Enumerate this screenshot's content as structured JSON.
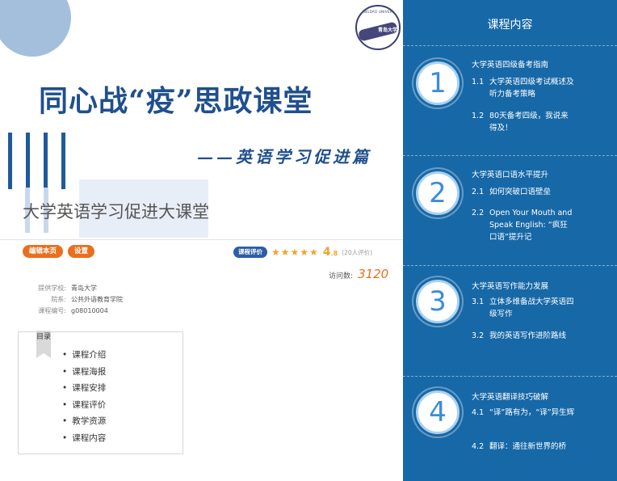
{
  "hero": {
    "title": "同心战“疫”思政课堂",
    "subtitle": "——英语学习促进篇",
    "course_name": "大学英语学习促进大课堂",
    "logo_seal": "青岛大学",
    "logo_arc": "QINGDAO UNIVERSITY"
  },
  "actions": {
    "edit_label": "编辑本页",
    "settings_label": "设置"
  },
  "rating": {
    "badge": "课程评价",
    "stars": "★★★★★",
    "score_int": "4",
    "score_dec": ".8",
    "count": "(20人评价)"
  },
  "visits": {
    "label": "访问数:",
    "count": "3120"
  },
  "meta": {
    "school_k": "提供学校:",
    "school_v": "青岛大学",
    "dept_k": "院系:",
    "dept_v": "公共外语教育学院",
    "code_k": "课程编号:",
    "code_v": "g08010004"
  },
  "toc": {
    "flag": "目录",
    "items": [
      "课程介绍",
      "课程海报",
      "课程安排",
      "课程评价",
      "教学资源",
      "课程内容"
    ]
  },
  "panel": {
    "title": "课程内容",
    "sections": [
      {
        "num": "1",
        "head": "大学英语四级备考指南",
        "items": [
          {
            "no": "1.1",
            "text": "大学英语四级考试概述及听力备考策略"
          },
          {
            "no": "1.2",
            "text": "80天备考四级，我说来得及！"
          }
        ]
      },
      {
        "num": "2",
        "head": "大学英语口语水平提升",
        "items": [
          {
            "no": "2.1",
            "text": "如何突破口语壁垒"
          },
          {
            "no": "2.2",
            "text": "Open Your Mouth and Speak English: “疯狂口语”提升记"
          }
        ]
      },
      {
        "num": "3",
        "head": "大学英语写作能力发展",
        "items": [
          {
            "no": "3.1",
            "text": "立体多维备战大学英语四级写作"
          },
          {
            "no": "3.2",
            "text": "我的英语写作进阶路线"
          }
        ]
      },
      {
        "num": "4",
        "head": "大学英语翻译技巧破解",
        "items": [
          {
            "no": "4.1",
            "text": "“译”路有为，“译”异生辉"
          },
          {
            "no": "4.2",
            "text": "翻译：通往新世界的桥"
          }
        ]
      }
    ]
  },
  "colors": {
    "panel_bg": "#1768a7",
    "accent_orange": "#e96f1f",
    "title_blue": "#1f4f8e",
    "star": "#f0a32c"
  }
}
